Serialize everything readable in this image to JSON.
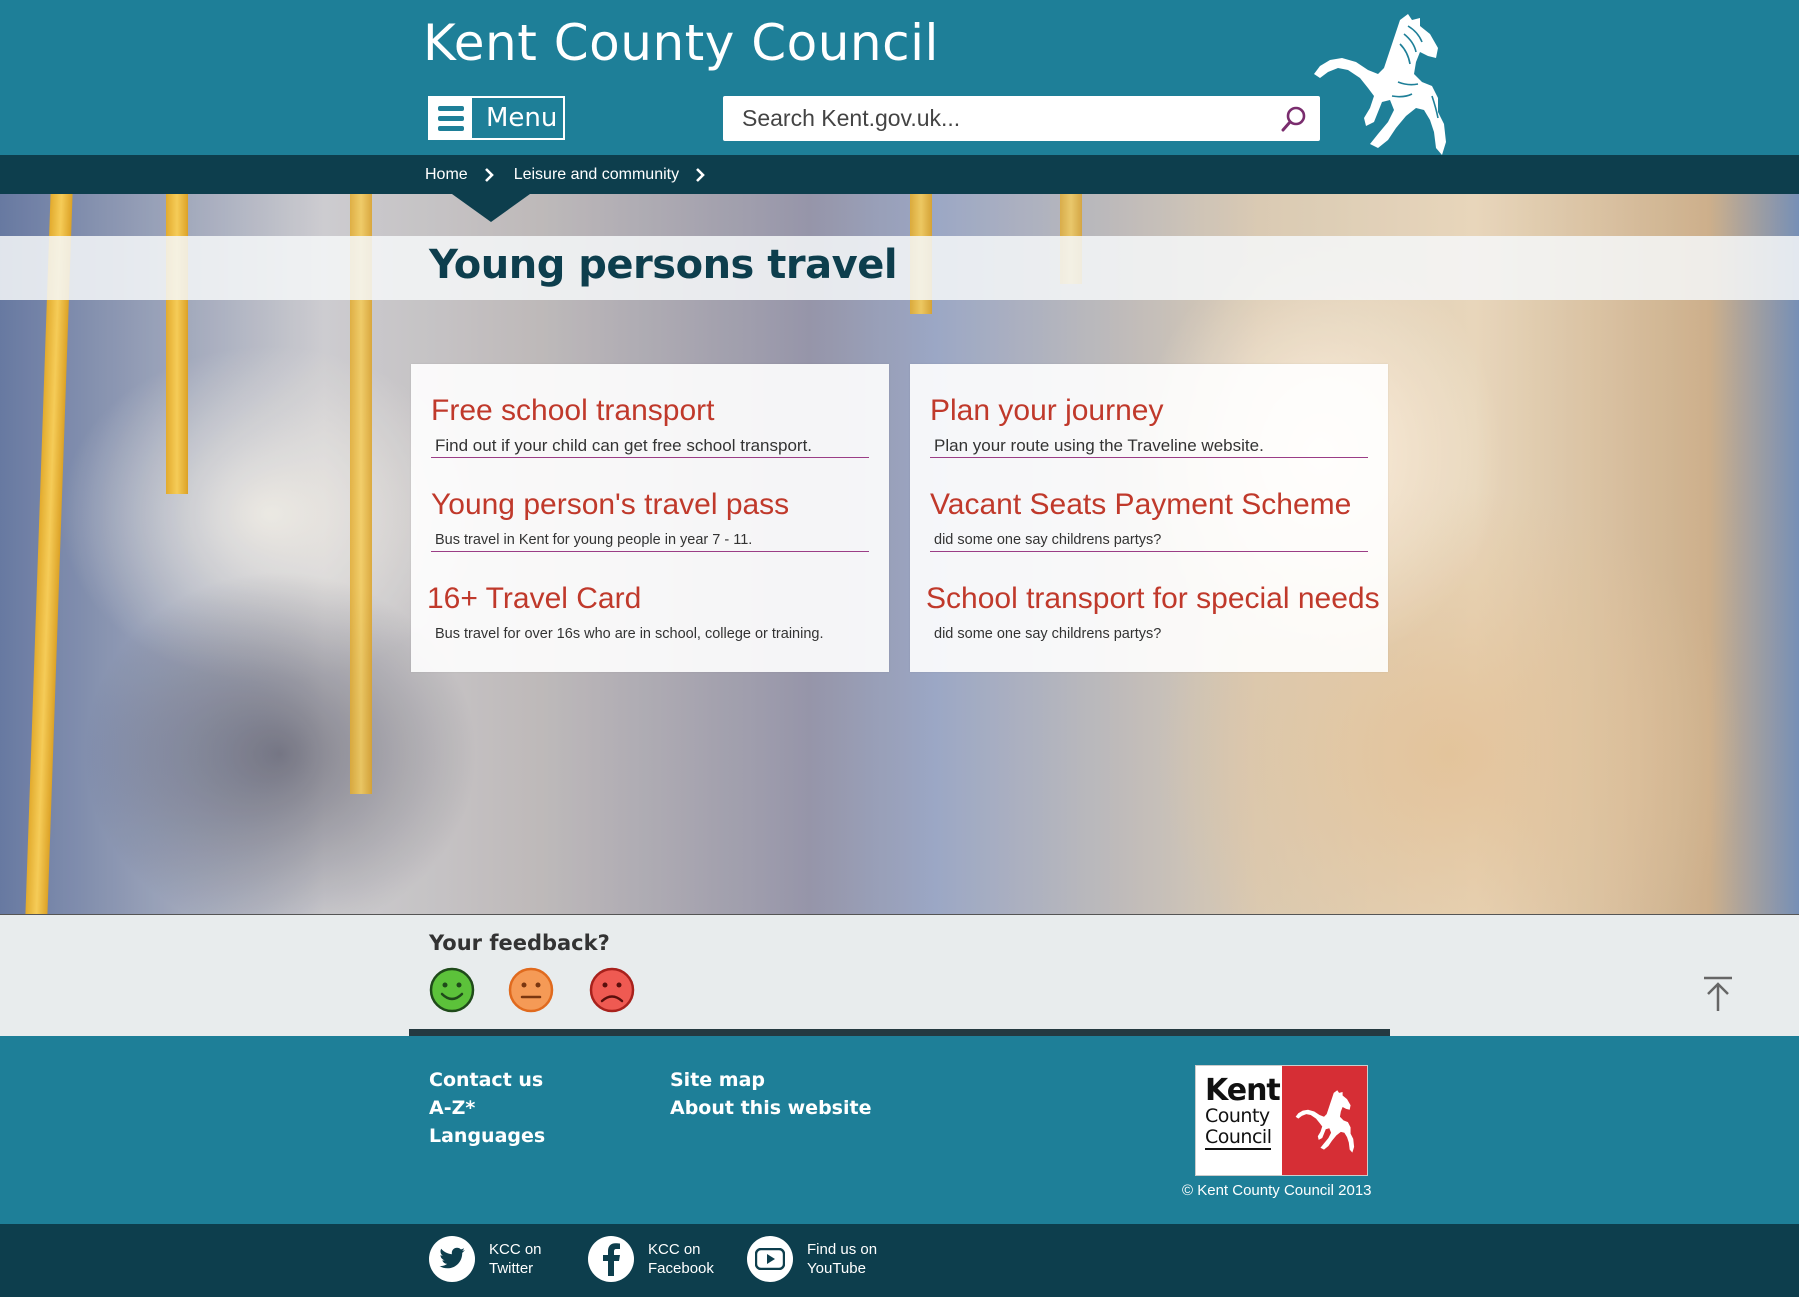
{
  "header": {
    "site_title": "Kent County Council",
    "menu_label": "Menu",
    "search_placeholder": "Search Kent.gov.uk..."
  },
  "breadcrumb": [
    {
      "label": "Home"
    },
    {
      "label": "Leisure and community"
    }
  ],
  "page": {
    "title": "Young persons travel"
  },
  "cards": {
    "left": [
      {
        "title": "Free school transport",
        "description": "Find out if your child can get free school transport."
      },
      {
        "title": "Young person's travel pass",
        "description": "Bus travel in Kent for young people in year 7 - 11."
      },
      {
        "title": "16+ Travel Card",
        "description": "Bus travel for over 16s who are in school, college or training."
      }
    ],
    "right": [
      {
        "title": "Plan your journey",
        "description": "Plan your route using the Traveline website."
      },
      {
        "title": "Vacant Seats Payment Scheme",
        "description": "did some one say childrens partys?"
      },
      {
        "title": "School transport for special needs",
        "description": "did some one say childrens partys?"
      }
    ]
  },
  "feedback": {
    "title": "Your feedback?",
    "options": [
      "happy-face-icon",
      "neutral-face-icon",
      "sad-face-icon"
    ],
    "colors": {
      "happy": "#4caf32",
      "neutral": "#f08a3c",
      "sad": "#e0473f"
    }
  },
  "footer": {
    "col1": [
      "Contact us",
      "A-Z*",
      "Languages"
    ],
    "col2": [
      "Site map",
      "About this website"
    ],
    "badge": {
      "line1": "Kent",
      "line2": "County",
      "line3": "Council"
    },
    "copyright": "© Kent County Council 2013"
  },
  "social": [
    {
      "line1": "KCC on",
      "line2": "Twitter",
      "icon": "twitter-icon"
    },
    {
      "line1": "KCC on",
      "line2": "Facebook",
      "icon": "facebook-icon"
    },
    {
      "line1": "Find us on",
      "line2": "YouTube",
      "icon": "youtube-icon"
    }
  ],
  "colors": {
    "brand_teal": "#1e7f98",
    "dark_teal": "#0d3e4d",
    "link_red": "#c0392b",
    "divider_purple": "#9b3d86",
    "badge_red": "#d62e35"
  }
}
